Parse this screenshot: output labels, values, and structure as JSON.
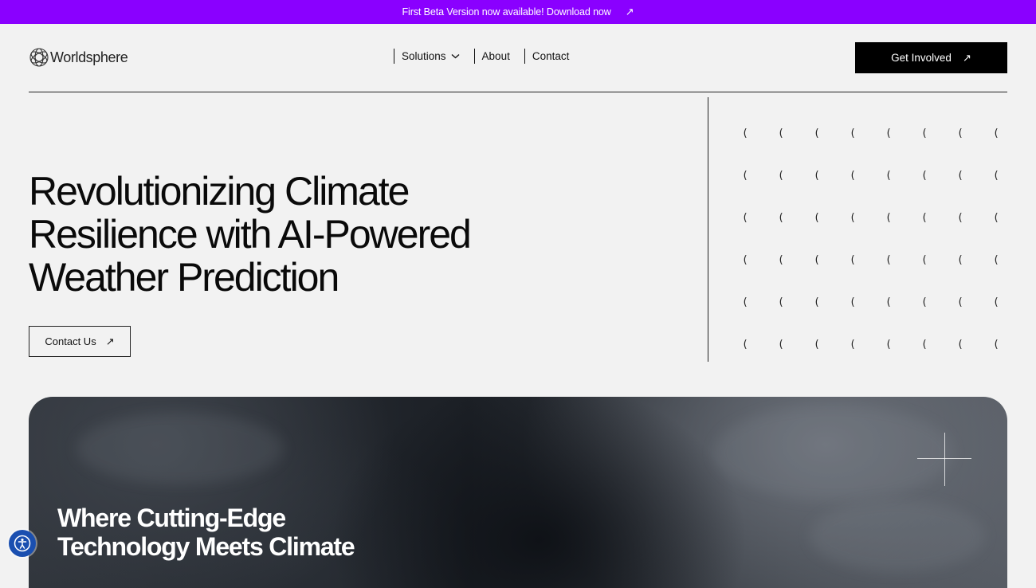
{
  "announcement": {
    "text": "First Beta Version now available! Download now",
    "arrow_icon": "arrow-up-right-icon",
    "bg_color": "#8a00ff"
  },
  "logo": {
    "name": "Worldsphere",
    "icon": "globe-rings-icon"
  },
  "nav": {
    "items": [
      {
        "label": "Solutions",
        "has_dropdown": true
      },
      {
        "label": "About",
        "has_dropdown": false
      },
      {
        "label": "Contact",
        "has_dropdown": false
      }
    ]
  },
  "header": {
    "cta_label": "Get Involved",
    "cta_icon": "arrow-up-right-icon"
  },
  "hero": {
    "title_lines": [
      "Revolutionizing Climate",
      "Resilience with AI-Powered",
      "Weather Prediction"
    ],
    "cta_label": "Contact Us",
    "pattern_glyph": "(",
    "pattern_rows": 6,
    "pattern_cols": 8
  },
  "media": {
    "title_lines": [
      "Where Cutting-Edge",
      "Technology Meets Climate"
    ],
    "icon": "plus-icon"
  },
  "accessibility": {
    "icon": "accessibility-icon",
    "color": "#1a4fb0"
  },
  "glyphs": {
    "arrow": "↗"
  }
}
